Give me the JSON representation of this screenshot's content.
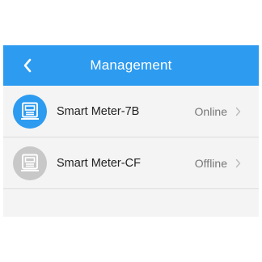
{
  "header": {
    "title": "Management",
    "background_color": "#2d9bf0",
    "back_icon": "chevron-left-icon"
  },
  "devices": [
    {
      "name": "Smart Meter-7B",
      "status": "Online",
      "icon": "smart-meter-icon",
      "icon_color": "#2d9bf0"
    },
    {
      "name": "Smart Meter-CF",
      "status": "Offline",
      "icon": "smart-meter-icon",
      "icon_color": "#c8c8c8"
    }
  ]
}
